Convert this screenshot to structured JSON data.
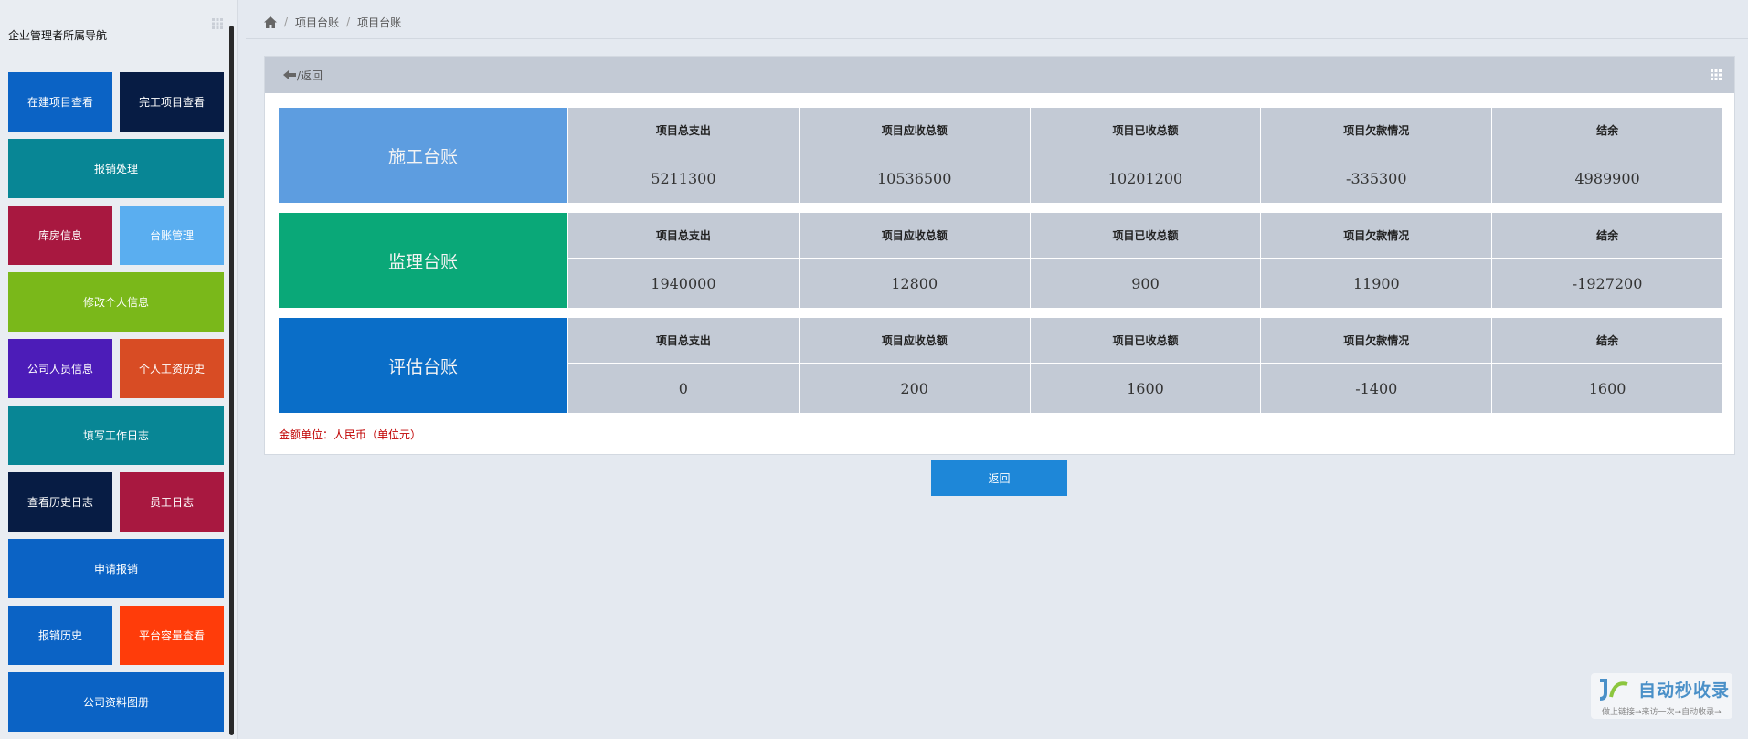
{
  "sidebar": {
    "title": "企业管理者所属导航",
    "tiles": [
      {
        "label": "在建项目查看",
        "color": "#0b63c5"
      },
      {
        "label": "完工项目查看",
        "color": "#071c44"
      },
      {
        "label": "报销处理",
        "color": "#088695"
      },
      {
        "label": "库房信息",
        "color": "#a81840"
      },
      {
        "label": "台账管理",
        "color": "#5aaef0"
      },
      {
        "label": "修改个人信息",
        "color": "#7ab81a"
      },
      {
        "label": "公司人员信息",
        "color": "#4c1cb8"
      },
      {
        "label": "个人工资历史",
        "color": "#d84c24"
      },
      {
        "label": "填写工作日志",
        "color": "#088695"
      },
      {
        "label": "查看历史日志",
        "color": "#071c44"
      },
      {
        "label": "员工日志",
        "color": "#a81840"
      },
      {
        "label": "申请报销",
        "color": "#0b63c5"
      },
      {
        "label": "报销历史",
        "color": "#0b63c5"
      },
      {
        "label": "平台容量查看",
        "color": "#ff3c0a"
      },
      {
        "label": "公司资料图册",
        "color": "#0b63c5"
      }
    ]
  },
  "breadcrumb": {
    "items": [
      "项目台账",
      "项目台账"
    ]
  },
  "panel": {
    "header": "/返回",
    "headers": [
      "项目总支出",
      "项目应收总额",
      "项目已收总额",
      "项目欠款情况",
      "结余"
    ],
    "ledgers": [
      {
        "name": "施工台账",
        "color": "#5d9de0",
        "values": [
          "5211300",
          "10536500",
          "10201200",
          "-335300",
          "4989900"
        ]
      },
      {
        "name": "监理台账",
        "color": "#0aa878",
        "values": [
          "1940000",
          "12800",
          "900",
          "11900",
          "-1927200"
        ]
      },
      {
        "name": "评估台账",
        "color": "#0a6ec8",
        "values": [
          "0",
          "200",
          "1600",
          "-1400",
          "1600"
        ]
      }
    ],
    "unit_note": "金额单位：人民币（单位元）"
  },
  "back_button": "返回",
  "watermark": {
    "text": "自动秒收录",
    "sub": "做上链接→来访一次→自动收录→"
  }
}
